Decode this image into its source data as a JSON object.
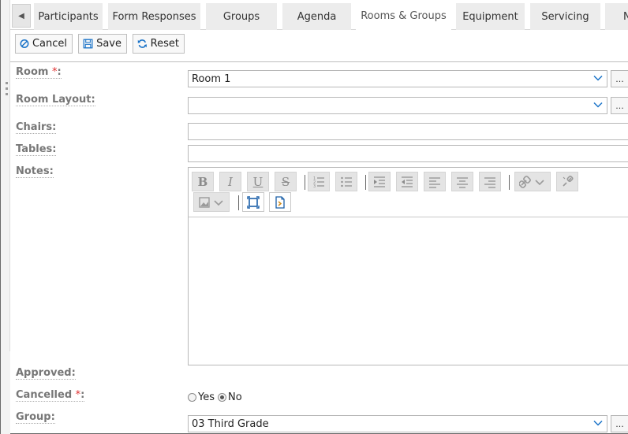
{
  "tabs": [
    {
      "label": "Participants",
      "active": false
    },
    {
      "label": "Form Responses",
      "active": false
    },
    {
      "label": "Groups",
      "active": false
    },
    {
      "label": "Agenda",
      "active": false
    },
    {
      "label": "Rooms & Groups",
      "active": true
    },
    {
      "label": "Equipment",
      "active": false
    },
    {
      "label": "Servicing",
      "active": false
    },
    {
      "label": "N",
      "active": false
    }
  ],
  "toolbar": {
    "cancel_label": "Cancel",
    "save_label": "Save",
    "reset_label": "Reset"
  },
  "form": {
    "room": {
      "label": "Room",
      "required_mark": "*",
      "suffix": ":",
      "value": "Room 1",
      "more": "..."
    },
    "room_layout": {
      "label": "Room Layout:",
      "value": "",
      "more": "..."
    },
    "chairs": {
      "label": "Chairs:",
      "value": ""
    },
    "tables": {
      "label": "Tables:",
      "value": ""
    },
    "notes": {
      "label": "Notes:",
      "value": ""
    },
    "approved": {
      "label": "Approved:"
    },
    "cancelled": {
      "label": "Cancelled",
      "required_mark": "*",
      "suffix": ":",
      "options": [
        {
          "label": "Yes",
          "checked": false
        },
        {
          "label": "No",
          "checked": true
        }
      ]
    },
    "group": {
      "label": "Group:",
      "value": "03 Third Grade",
      "more": "..."
    }
  },
  "editor_buttons": {
    "bold": "B",
    "italic": "I",
    "underline": "U",
    "strike": "S"
  },
  "colors": {
    "required": "#e03030",
    "label": "#777777",
    "accent_icon": "#1a73c8"
  }
}
